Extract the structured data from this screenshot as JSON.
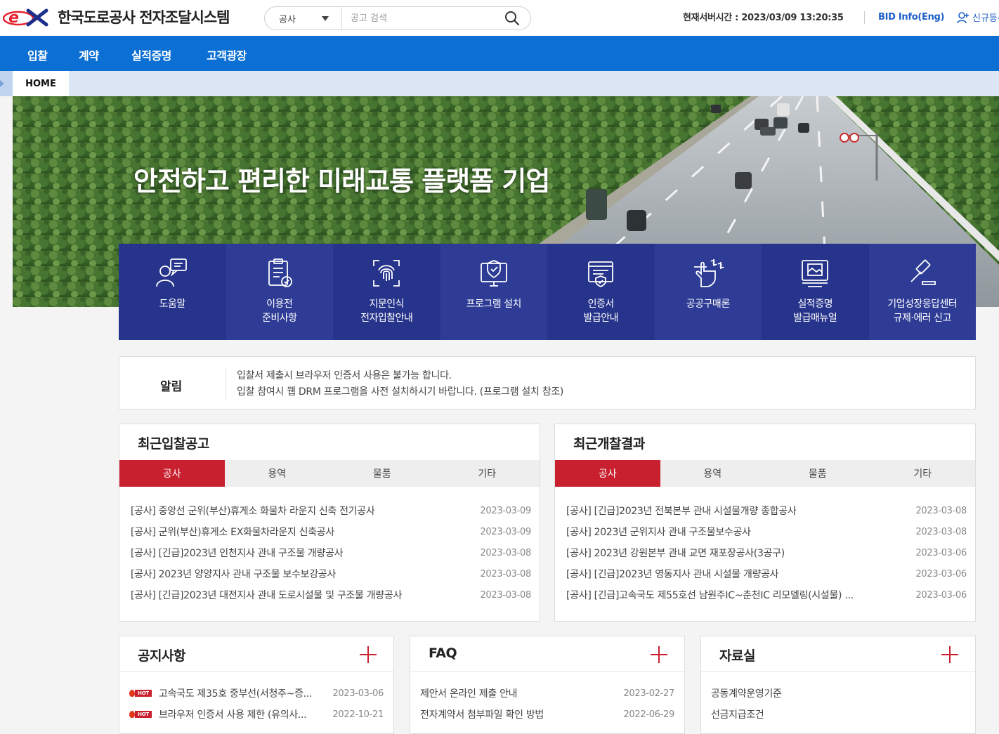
{
  "header": {
    "logo_brand": "ex",
    "logo_text": "한국도로공사 전자조달시스템",
    "search": {
      "category": "공사",
      "placeholder": "공고 검색"
    },
    "server_time": "현재서버시간 : 2023/03/09 13:20:35",
    "bid_info": "BID Info(Eng)",
    "signup": "신규등록"
  },
  "gnb": [
    "입찰",
    "계약",
    "실적증명",
    "고객광장"
  ],
  "location": {
    "home": "HOME"
  },
  "hero": {
    "title": "안전하고 편리한 미래교통 플랫폼 기업"
  },
  "quick_menu": [
    {
      "label": "도움말",
      "icon": "help-chat-icon",
      "color": "#27348b"
    },
    {
      "label": "이용전\n준비사항",
      "icon": "checklist-icon",
      "color": "#2e3c96"
    },
    {
      "label": "지문인식\n전자입찰안내",
      "icon": "fingerprint-icon",
      "color": "#27348b"
    },
    {
      "label": "프로그램 설치",
      "icon": "monitor-shield-icon",
      "color": "#2e3c96"
    },
    {
      "label": "인증서\n발급안내",
      "icon": "certificate-icon",
      "color": "#27348b"
    },
    {
      "label": "공공구매론",
      "icon": "hand-money-icon",
      "color": "#2e3c96"
    },
    {
      "label": "실적증명\n발급매뉴얼",
      "icon": "screen-manual-icon",
      "color": "#27348b"
    },
    {
      "label": "기업성장응답센터\n규제·에러 신고",
      "icon": "gavel-icon",
      "color": "#2e3c96"
    }
  ],
  "notice": {
    "title": "알림",
    "lines": [
      "입찰서 제출시 브라우저 인증서 사용은 불가능 합니다.",
      "입찰 참여시 웹 DRM 프로그램을 사전 설치하시기 바랍니다. (프로그램 설치 참조)"
    ]
  },
  "recent_bids": {
    "title": "최근입찰공고",
    "tabs": [
      "공사",
      "용역",
      "물품",
      "기타"
    ],
    "active_tab": 0,
    "rows": [
      {
        "title": "[공사] 중앙선 군위(부산)휴게소 화물차 라운지 신축 전기공사",
        "date": "2023-03-09"
      },
      {
        "title": "[공사] 군위(부산)휴게소 EX화물차라운지 신축공사",
        "date": "2023-03-09"
      },
      {
        "title": "[공사] [긴급]2023년 인천지사 관내 구조물 개량공사",
        "date": "2023-03-08"
      },
      {
        "title": "[공사] 2023년 양양지사 관내 구조물 보수보강공사",
        "date": "2023-03-08"
      },
      {
        "title": "[공사] [긴급]2023년 대전지사 관내 도로시설물 및 구조물 개량공사",
        "date": "2023-03-08"
      }
    ]
  },
  "recent_results": {
    "title": "최근개찰결과",
    "tabs": [
      "공사",
      "용역",
      "물품",
      "기타"
    ],
    "active_tab": 0,
    "rows": [
      {
        "title": "[공사] [긴급]2023년 전북본부 관내 시설물개량 종합공사",
        "date": "2023-03-08"
      },
      {
        "title": "[공사] 2023년 군위지사 관내 구조물보수공사",
        "date": "2023-03-08"
      },
      {
        "title": "[공사] 2023년 강원본부 관내 교면 재포장공사(3공구)",
        "date": "2023-03-06"
      },
      {
        "title": "[공사] [긴급]2023년 영동지사 관내 시설물 개량공사",
        "date": "2023-03-06"
      },
      {
        "title": "[공사] [긴급]고속국도 제55호선 남원주IC~춘천IC 리모델링(시설물) ...",
        "date": "2023-03-06"
      }
    ]
  },
  "notices_board": {
    "title": "공지사항",
    "rows": [
      {
        "hot": true,
        "hot_label": "HOT",
        "title": "고속국도 제35호 중부선(서청주~증...",
        "date": "2023-03-06"
      },
      {
        "hot": true,
        "hot_label": "HOT",
        "title": "브라우저 인증서 사용 제한 (유의사...",
        "date": "2022-10-21"
      }
    ]
  },
  "faq_board": {
    "title": "FAQ",
    "rows": [
      {
        "title": "제안서 온라인 제출 안내",
        "date": "2023-02-27"
      },
      {
        "title": "전자계약서 첨부파일 확인 방법",
        "date": "2022-06-29"
      }
    ]
  },
  "archive_board": {
    "title": "자료실",
    "rows": [
      {
        "title": "공동계약운영기준"
      },
      {
        "title": "선금지급조건"
      }
    ]
  },
  "colors": {
    "brand_red": "#e5232f",
    "brand_navy": "#1c2f8a",
    "gnb_blue": "#0b6fd3",
    "quick_navy": "#27348b",
    "tab_active_red": "#c8202f",
    "link_blue": "#1f5fc9"
  }
}
